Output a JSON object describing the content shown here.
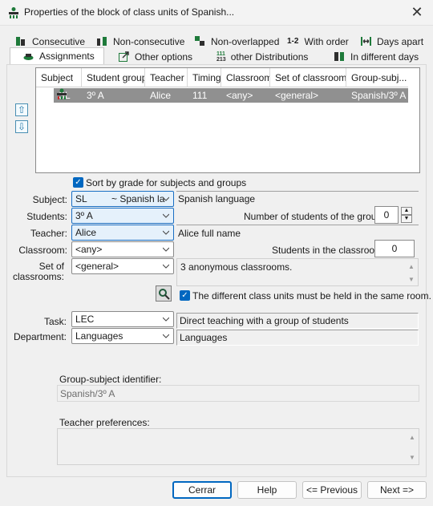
{
  "window": {
    "title": "Properties of the block of class units of Spanish..."
  },
  "tabs_row1": [
    {
      "label": "Consecutive",
      "icon": "consecutive-icon"
    },
    {
      "label": "Non-consecutive",
      "icon": "non-consecutive-icon"
    },
    {
      "label": "Non-overlapped",
      "icon": "non-overlapped-icon"
    },
    {
      "label": "With order",
      "icon": "with-order-icon",
      "icon_text": "1-2"
    },
    {
      "label": "Days apart",
      "icon": "days-apart-icon"
    }
  ],
  "tabs_row2": [
    {
      "label": "Assignments",
      "icon": "assignments-icon",
      "active": true
    },
    {
      "label": "Other options",
      "icon": "other-options-icon"
    },
    {
      "label": "other Distributions",
      "icon": "distributions-icon",
      "icon_text_top": "111",
      "icon_text_bottom": "213"
    },
    {
      "label": "In different days",
      "icon": "different-days-icon"
    }
  ],
  "grid": {
    "columns": [
      "Subject",
      "Student group",
      "Teacher",
      "Timing",
      "Classroom",
      "Set of classrooms",
      "Group-subj..."
    ],
    "rows": [
      {
        "subject": "SL",
        "student_group": "3º A",
        "teacher": "Alice",
        "timing": "111",
        "classroom": "<any>",
        "set_of_classrooms": "<general>",
        "group_subject": "Spanish/3º A"
      }
    ]
  },
  "sort_checkbox": {
    "label": "Sort by grade for subjects and groups",
    "checked": true
  },
  "form": {
    "subject": {
      "label": "Subject:",
      "value": "SL",
      "value_extra": "~ Spanish la",
      "description": "Spanish language"
    },
    "students": {
      "label": "Students:",
      "value": "3º A",
      "count_label": "Number of students of the group:",
      "count": "0"
    },
    "teacher": {
      "label": "Teacher:",
      "value": "Alice",
      "description": "Alice full name"
    },
    "classroom": {
      "label": "Classroom:",
      "value": "<any>",
      "students_label": "Students in the classroom:",
      "students_count": "0"
    },
    "set_of_classrooms": {
      "label_line1": "Set of",
      "label_line2": "classrooms:",
      "value": "<general>",
      "description": "3 anonymous classrooms."
    },
    "same_room": {
      "label": "The different class units must be held in the same room.",
      "checked": true
    },
    "task": {
      "label": "Task:",
      "value": "LEC",
      "description": "Direct teaching with a group of students"
    },
    "department": {
      "label": "Department:",
      "value": "Languages",
      "description": "Languages"
    },
    "group_subject_identifier": {
      "label": "Group-subject identifier:",
      "value": "Spanish/3º A"
    },
    "teacher_preferences": {
      "label": "Teacher preferences:",
      "value": ""
    }
  },
  "buttons": {
    "close": "Cerrar",
    "help": "Help",
    "previous": "<= Previous",
    "next": "Next =>"
  },
  "colors": {
    "accent": "#0067c0",
    "selected_row": "#909090",
    "icon_green": "#1e7a3a"
  }
}
